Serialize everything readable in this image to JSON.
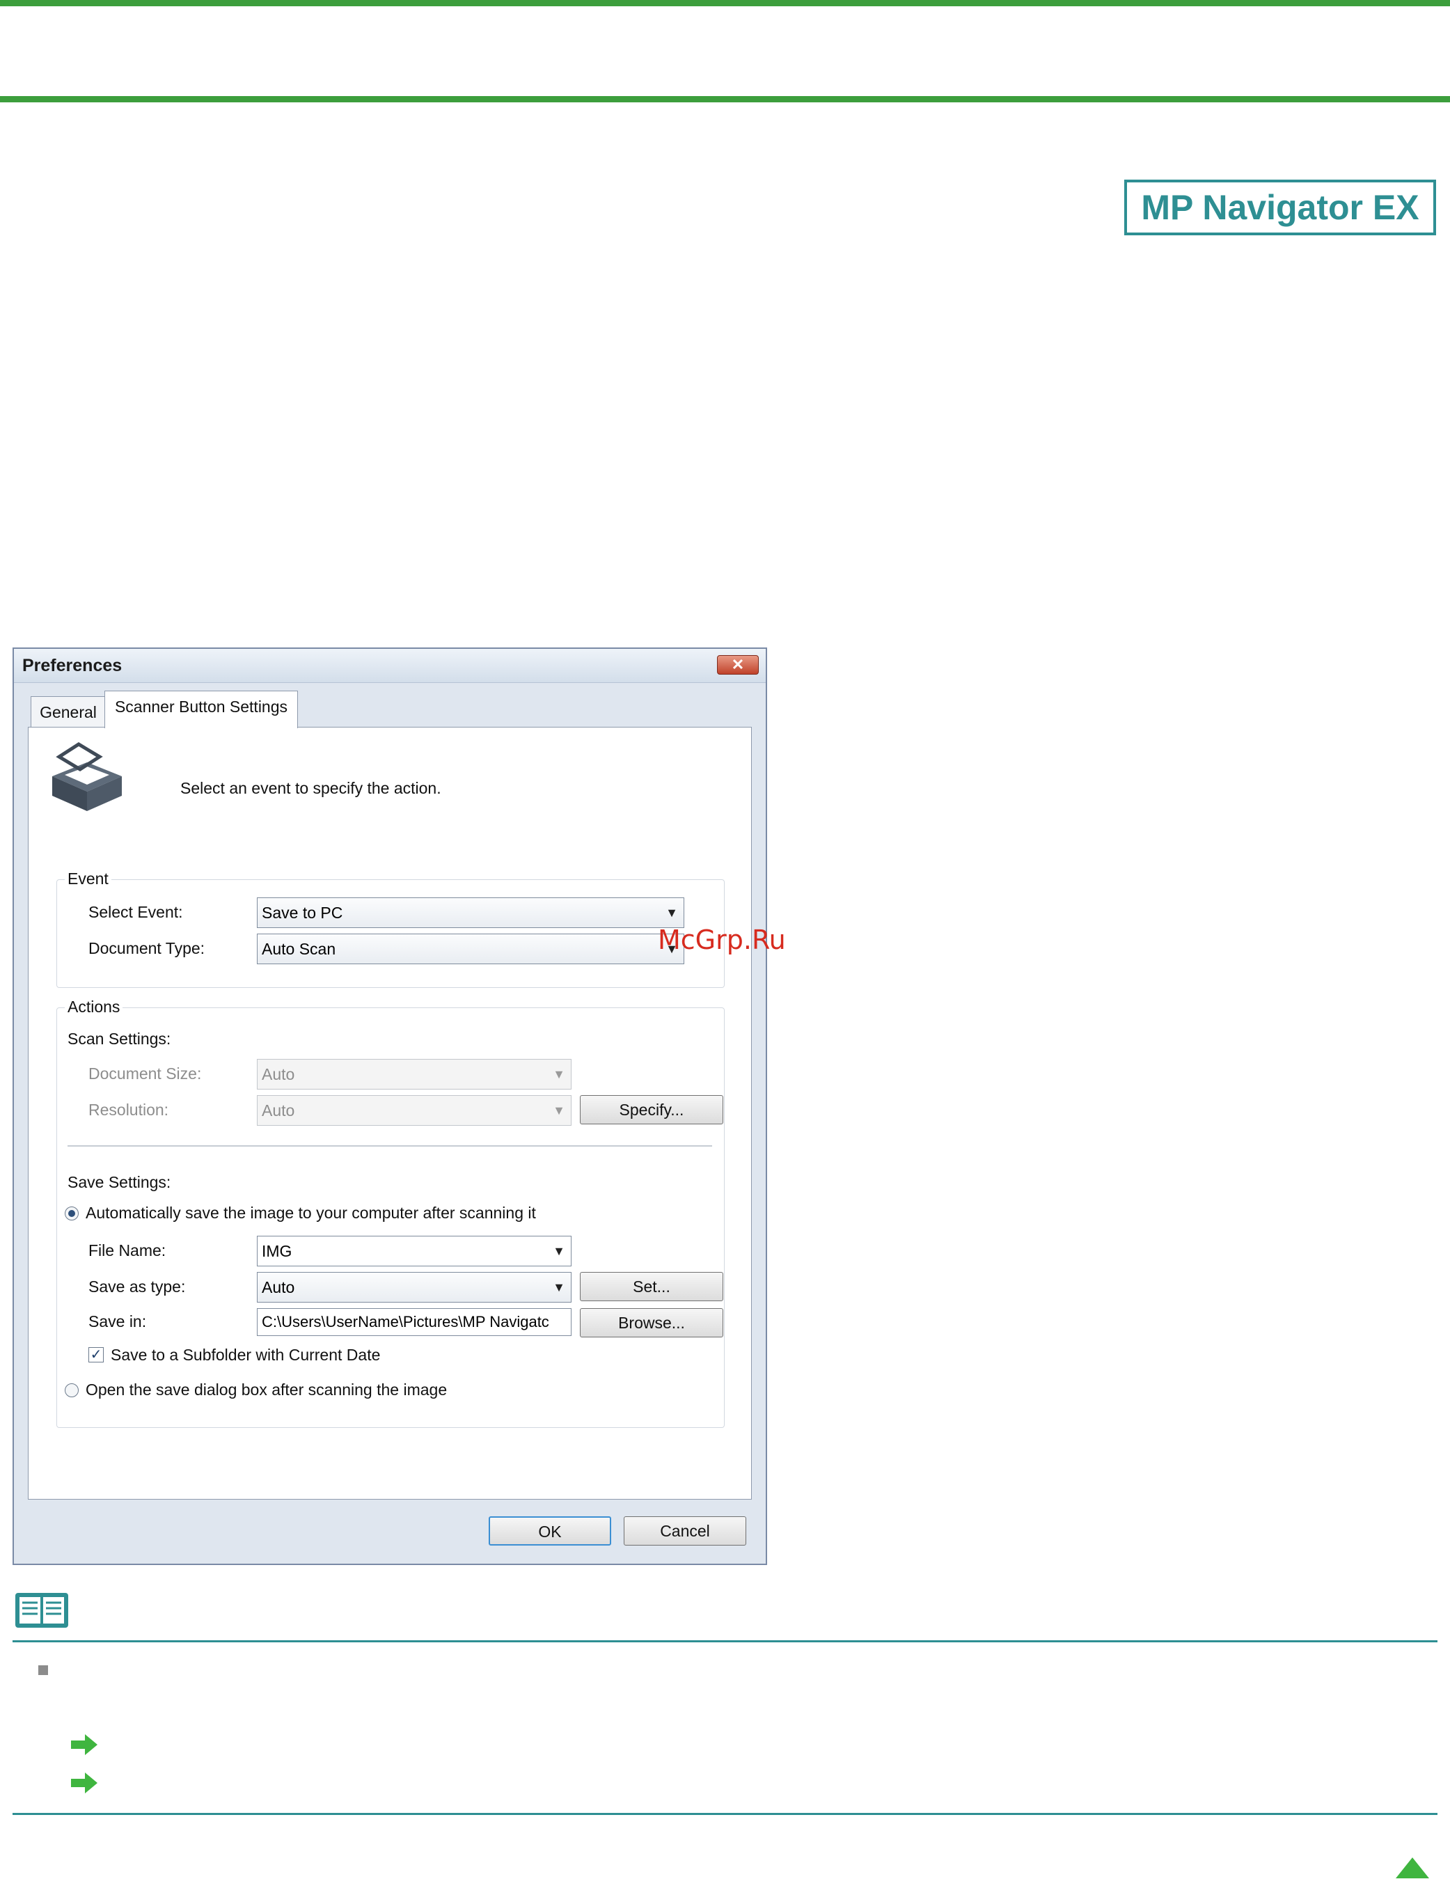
{
  "header": {
    "logo_text": "MP Navigator EX",
    "watermark": "McGrp.Ru"
  },
  "dialog": {
    "title": "Preferences",
    "close_glyph": "✕",
    "tabs": [
      {
        "label": "General",
        "active": false
      },
      {
        "label": "Scanner Button Settings",
        "active": true
      }
    ],
    "intro_text": "Select an event to specify the action.",
    "event_group": {
      "title": "Event",
      "select_event_label": "Select Event:",
      "select_event_value": "Save to PC",
      "document_type_label": "Document Type:",
      "document_type_value": "Auto Scan"
    },
    "actions_group": {
      "title": "Actions",
      "scan_settings_label": "Scan Settings:",
      "document_size_label": "Document Size:",
      "document_size_value": "Auto",
      "resolution_label": "Resolution:",
      "resolution_value": "Auto",
      "specify_button": "Specify...",
      "save_settings_label": "Save Settings:",
      "auto_save_option": "Automatically save the image to your computer after scanning it",
      "auto_save_selected": true,
      "file_name_label": "File Name:",
      "file_name_value": "IMG",
      "save_as_type_label": "Save as type:",
      "save_as_type_value": "Auto",
      "set_button": "Set...",
      "save_in_label": "Save in:",
      "save_in_value": "C:\\Users\\UserName\\Pictures\\MP Navigatc",
      "browse_button": "Browse...",
      "subfolder_checkbox": "Save to a Subfolder with Current Date",
      "subfolder_checked": true,
      "open_dialog_option": "Open the save dialog box after scanning the image",
      "open_dialog_selected": false
    },
    "ok_button": "OK",
    "cancel_button": "Cancel"
  },
  "colors": {
    "green_rule": "#3c9e3c",
    "teal": "#2e8f93",
    "watermark": "#d72b1f"
  },
  "icons": [
    "scanner-icon",
    "note-book-icon",
    "green-arrow-icon",
    "top-triangle-icon"
  ]
}
